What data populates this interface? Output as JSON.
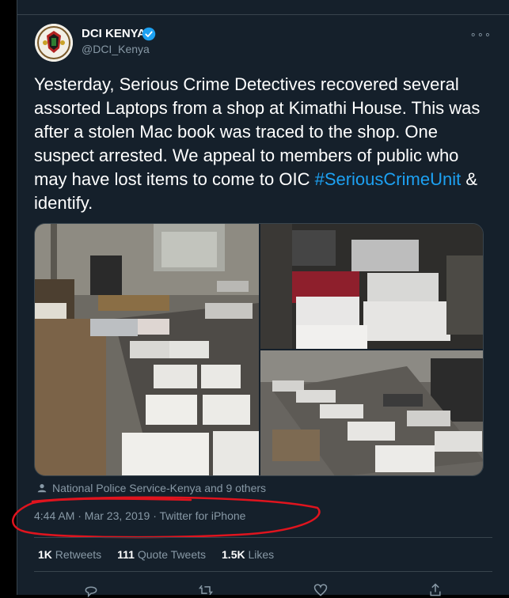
{
  "author": {
    "name": "DCI KENYA",
    "handle": "@DCI_Kenya"
  },
  "tweet": {
    "text_main": "Yesterday, Serious Crime Detectives recovered several assorted Laptops from a shop at Kimathi House. This was after a stolen Mac book was traced to the shop. One suspect arrested. We appeal to members of public who may have lost items to come to OIC ",
    "hashtag": "#SeriousCrimeUnit",
    "text_tail": " & identify."
  },
  "tagged": "National Police Service-Kenya and 9 others",
  "meta": "4:44 AM · Mar 23, 2019 · Twitter for iPhone",
  "stats": {
    "retweets_count": "1K",
    "retweets_label": "Retweets",
    "quotes_count": "111",
    "quotes_label": "Quote Tweets",
    "likes_count": "1.5K",
    "likes_label": "Likes"
  },
  "colors": {
    "background": "#15202b",
    "accent": "#1da1f2",
    "annotation": "#e0141e"
  }
}
